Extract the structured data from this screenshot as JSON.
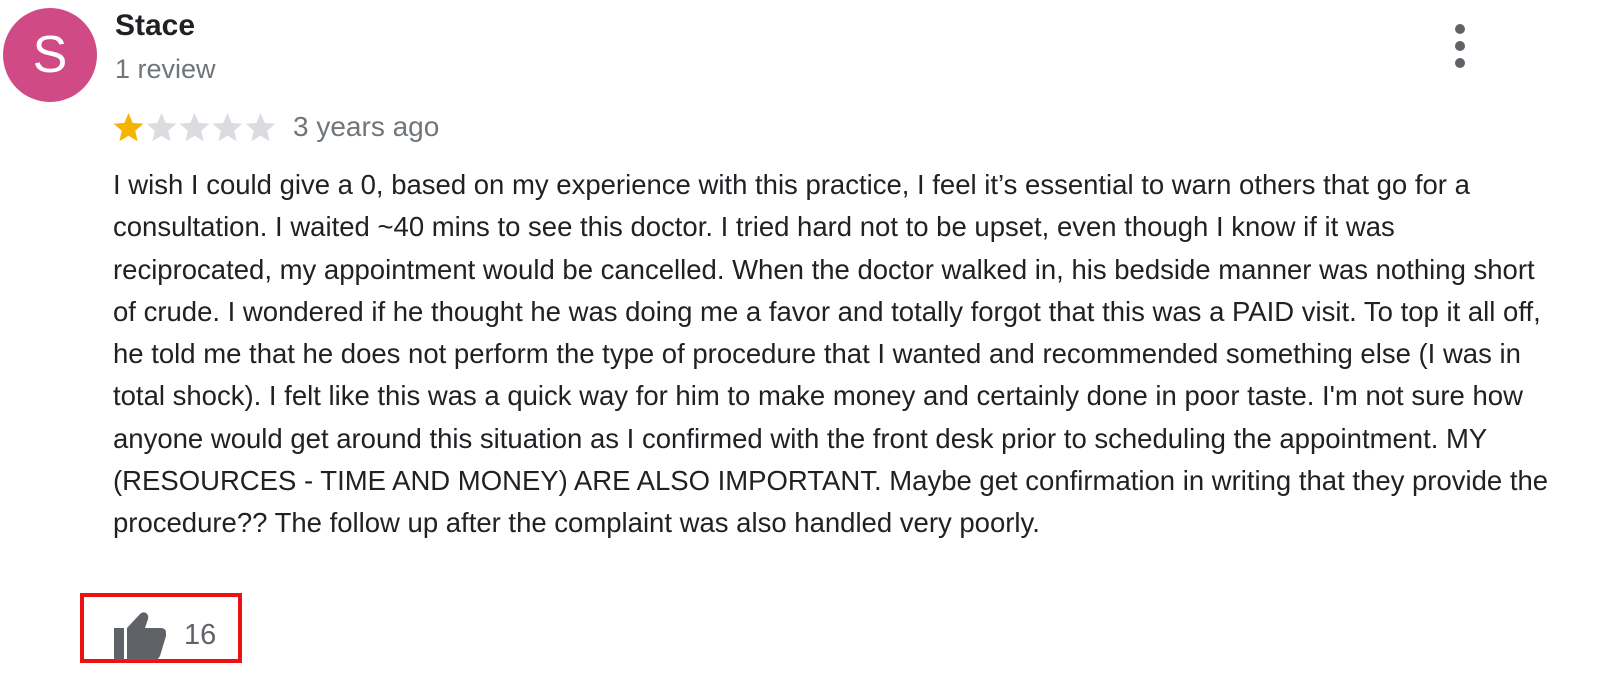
{
  "review": {
    "reviewer": {
      "initial": "S",
      "name": "Stace",
      "review_count": "1 review",
      "avatar_color": "#d04a86"
    },
    "rating": {
      "value": 1,
      "max": 5,
      "filled_color": "#f4b400",
      "empty_color": "#dadce0"
    },
    "date": "3 years ago",
    "text": "I wish I could give a 0, based on my experience with this practice, I feel it’s essential to warn others that go for a consultation. I waited ~40 mins to see this doctor. I tried hard not to be upset, even though I know if it was reciprocated, my appointment would be cancelled. When the doctor walked in, his bedside manner was nothing short of crude. I wondered if he thought he was doing me a favor and totally forgot that this was a PAID visit. To top it all off, he told me that he does not perform the type of procedure that I wanted and recommended something else (I was in total shock). I felt like this was a quick way for him to make money and certainly done in poor taste. I'm not sure how anyone would get around this situation as I confirmed with the front desk prior to scheduling the appointment. MY (RESOURCES - TIME AND MONEY) ARE ALSO IMPORTANT. Maybe get confirmation in writing that they provide the procedure?? The follow up after the complaint was also handled very poorly.",
    "likes": {
      "icon": "thumbs-up-icon",
      "count": "16"
    },
    "menu_icon": "more-vert-icon",
    "highlight_color": "#ee1111"
  }
}
